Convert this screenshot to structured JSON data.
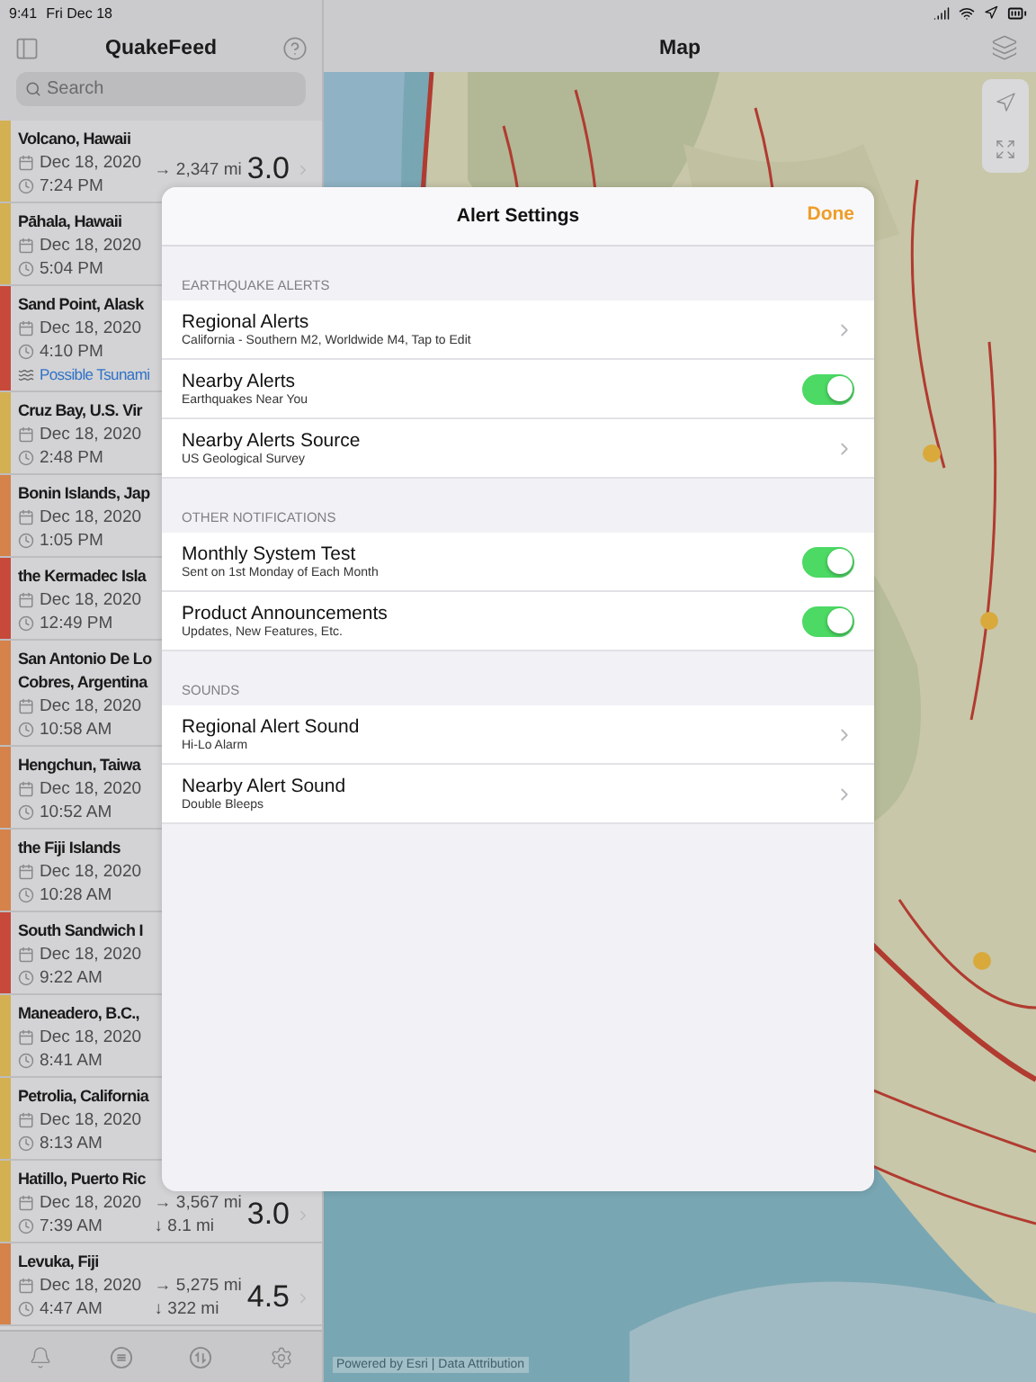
{
  "status_bar": {
    "time": "9:41",
    "date": "Fri Dec 18"
  },
  "sidebar": {
    "title": "QuakeFeed",
    "search": {
      "placeholder": "Search"
    },
    "quakes": [
      {
        "place": "Volcano, Hawaii",
        "date": "Dec 18, 2020",
        "time": "7:24 PM",
        "distance": "→ 2,347 mi",
        "magnitude": "3.0",
        "color": "#d3b052"
      },
      {
        "place": "Pāhala, Hawaii",
        "date": "Dec 18, 2020",
        "time": "5:04 PM",
        "color": "#d3b052"
      },
      {
        "place": "Sand Point, Alask",
        "date": "Dec 18, 2020",
        "time": "4:10 PM",
        "note": "Possible Tsunami",
        "color": "#c7493a"
      },
      {
        "place": "Cruz Bay, U.S. Vir",
        "date": "Dec 18, 2020",
        "time": "2:48 PM",
        "color": "#d3b052"
      },
      {
        "place": "Bonin Islands, Jap",
        "date": "Dec 18, 2020",
        "time": "1:05 PM",
        "color": "#d5824b"
      },
      {
        "place": "the Kermadec Isla",
        "date": "Dec 18, 2020",
        "time": "12:49 PM",
        "color": "#c7493a"
      },
      {
        "place": "San Antonio De Lo Cobres, Argentina",
        "date": "Dec 18, 2020",
        "time": "10:58 AM",
        "color": "#d5824b"
      },
      {
        "place": "Hengchun, Taiwa",
        "date": "Dec 18, 2020",
        "time": "10:52 AM",
        "color": "#d5824b"
      },
      {
        "place": "the Fiji Islands",
        "date": "Dec 18, 2020",
        "time": "10:28 AM",
        "color": "#d5824b"
      },
      {
        "place": "South Sandwich I",
        "date": "Dec 18, 2020",
        "time": "9:22 AM",
        "color": "#c7493a"
      },
      {
        "place": "Maneadero, B.C.,",
        "date": "Dec 18, 2020",
        "time": "8:41 AM",
        "color": "#d3b052"
      },
      {
        "place": "Petrolia, California",
        "date": "Dec 18, 2020",
        "time": "8:13 AM",
        "color": "#d3b052"
      },
      {
        "place": "Hatillo, Puerto Ric",
        "date": "Dec 18, 2020",
        "time": "7:39 AM",
        "distance": "→ 3,567 mi",
        "depth": "↓ 8.1 mi",
        "magnitude": "3.0",
        "color": "#d3b052"
      },
      {
        "place": "Levuka, Fiji",
        "date": "Dec 18, 2020",
        "time": "4:47 AM",
        "distance": "→ 5,275 mi",
        "depth": "↓ 322 mi",
        "magnitude": "4.5",
        "color": "#d5824b"
      }
    ]
  },
  "map": {
    "title": "Map",
    "attribution": "Powered by Esri | Data Attribution"
  },
  "sheet": {
    "title": "Alert Settings",
    "done": "Done",
    "sections": [
      {
        "header": "EARTHQUAKE ALERTS",
        "rows": [
          {
            "kind": "link",
            "title": "Regional Alerts",
            "subtitle": "California - Southern M2, Worldwide M4, Tap to Edit"
          },
          {
            "kind": "toggle",
            "title": "Nearby Alerts",
            "subtitle": "Earthquakes Near You",
            "on": true
          },
          {
            "kind": "link",
            "title": "Nearby Alerts Source",
            "subtitle": "US Geological Survey"
          }
        ]
      },
      {
        "header": "OTHER NOTIFICATIONS",
        "rows": [
          {
            "kind": "toggle",
            "title": "Monthly System Test",
            "subtitle": "Sent on 1st Monday of Each Month",
            "on": true
          },
          {
            "kind": "toggle",
            "title": "Product Announcements",
            "subtitle": "Updates, New Features, Etc.",
            "on": true
          }
        ]
      },
      {
        "header": "SOUNDS",
        "rows": [
          {
            "kind": "link",
            "title": "Regional Alert Sound",
            "subtitle": "Hi-Lo Alarm"
          },
          {
            "kind": "link",
            "title": "Nearby Alert Sound",
            "subtitle": "Double Bleeps"
          }
        ]
      }
    ]
  }
}
